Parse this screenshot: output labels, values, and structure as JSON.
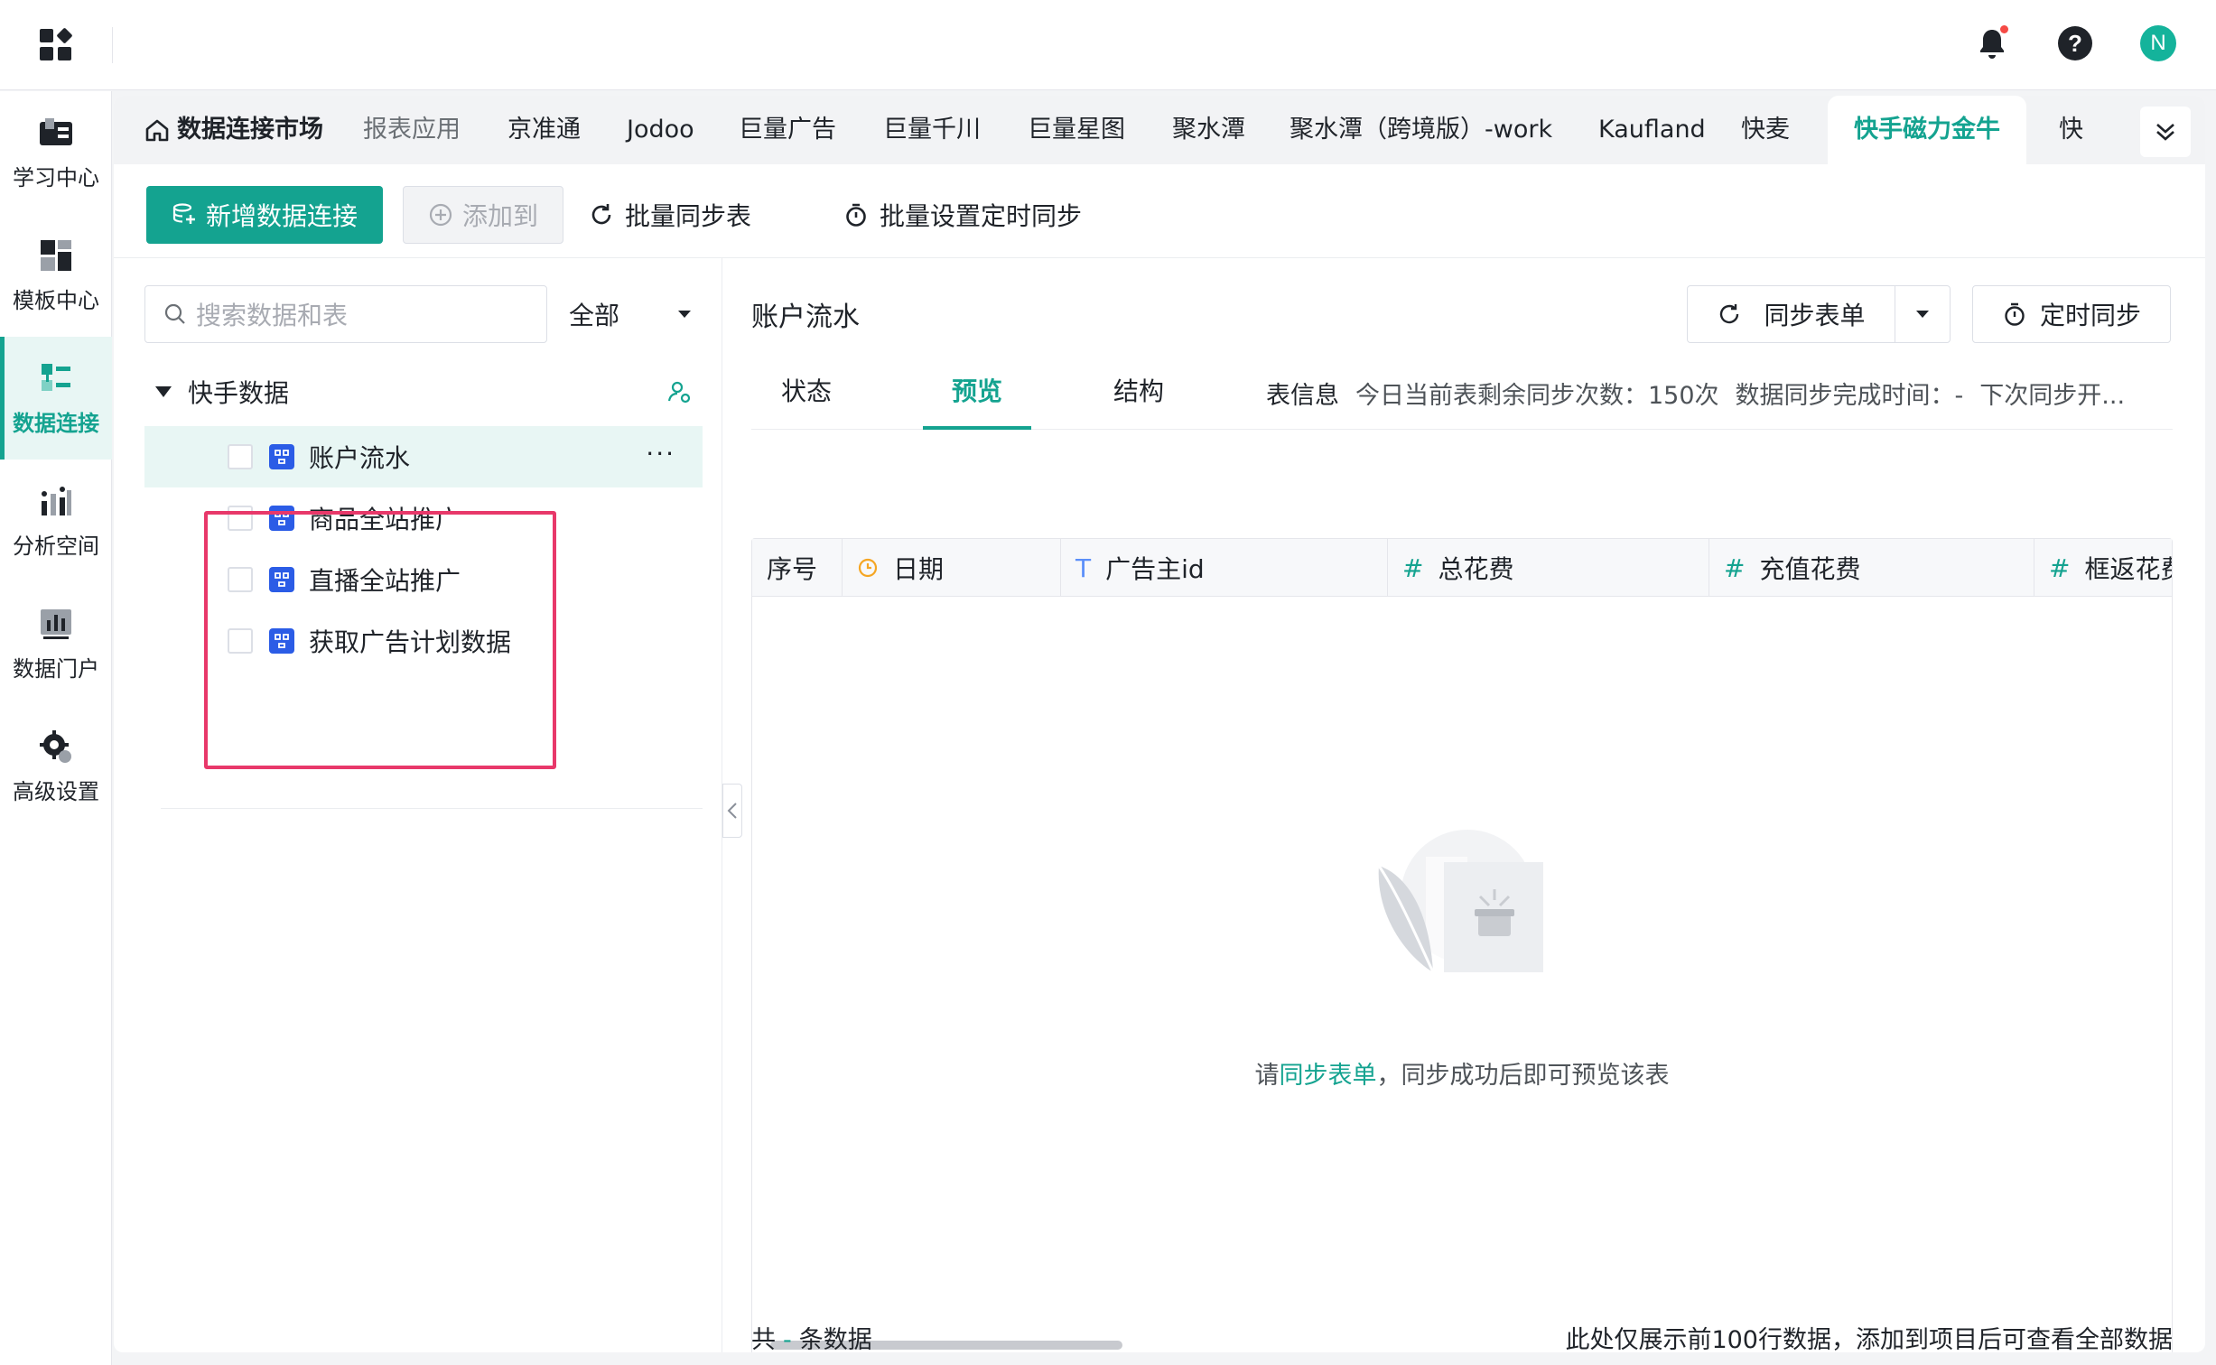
{
  "header": {
    "icons": [
      "apps-grid-icon",
      "bell-icon",
      "help-icon",
      "avatar"
    ],
    "avatar_letter": "N",
    "notification_dot": true
  },
  "sidebar": {
    "items": [
      {
        "label": "学习中心",
        "icon": "learning-center-icon",
        "active": false
      },
      {
        "label": "模板中心",
        "icon": "template-center-icon",
        "active": false
      },
      {
        "label": "数据连接",
        "icon": "data-connection-icon",
        "active": true
      },
      {
        "label": "分析空间",
        "icon": "analysis-space-icon",
        "active": false
      },
      {
        "label": "数据门户",
        "icon": "data-portal-icon",
        "active": false
      },
      {
        "label": "高级设置",
        "icon": "advanced-settings-icon",
        "active": false
      }
    ]
  },
  "tabs": {
    "home": "数据连接市场",
    "items": [
      "报表应用",
      "京准通",
      "Jodoo",
      "巨量广告",
      "巨量千川",
      "巨量星图",
      "聚水潭",
      "聚水潭（跨境版）-work",
      "Kaufland",
      "快麦",
      "快手磁力金牛",
      "快"
    ],
    "active": "快手磁力金牛"
  },
  "toolbar": {
    "new_connection": "新增数据连接",
    "add_to": "添加到",
    "batch_sync": "批量同步表",
    "batch_schedule": "批量设置定时同步"
  },
  "left_panel": {
    "search_placeholder": "搜索数据和表",
    "filter": "全部",
    "group": "快手数据",
    "items": [
      "账户流水",
      "商品全站推广",
      "直播全站推广",
      "获取广告计划数据"
    ],
    "selected": "账户流水",
    "more": "···"
  },
  "right_panel": {
    "title": "账户流水",
    "sync_button": "同步表单",
    "schedule_button": "定时同步",
    "subtabs": [
      "状态",
      "预览",
      "结构"
    ],
    "active_subtab": "预览",
    "info": {
      "label": "表信息",
      "remaining": "今日当前表剩余同步次数：150次",
      "finish_time": "数据同步完成时间：-",
      "next_sync": "下次同步开..."
    },
    "columns": [
      {
        "name": "序号",
        "type": ""
      },
      {
        "name": "日期",
        "type": "date"
      },
      {
        "name": "广告主id",
        "type": "text"
      },
      {
        "name": "总花费",
        "type": "number"
      },
      {
        "name": "充值花费",
        "type": "number"
      },
      {
        "name": "框返花费",
        "type": "number"
      }
    ],
    "type_symbols": {
      "text": "T",
      "number": "#"
    },
    "empty": {
      "prefix": "请",
      "link": "同步表单",
      "suffix": "，同步成功后即可预览该表"
    },
    "footer": {
      "count_prefix": "共",
      "count_value": "-",
      "count_suffix": "条数据",
      "note": "此处仅展示前100行数据，添加到项目后可查看全部数据"
    }
  },
  "colors": {
    "accent": "#14a390",
    "highlight": "#e8386a",
    "ds_icon": "#2b5ce6"
  }
}
